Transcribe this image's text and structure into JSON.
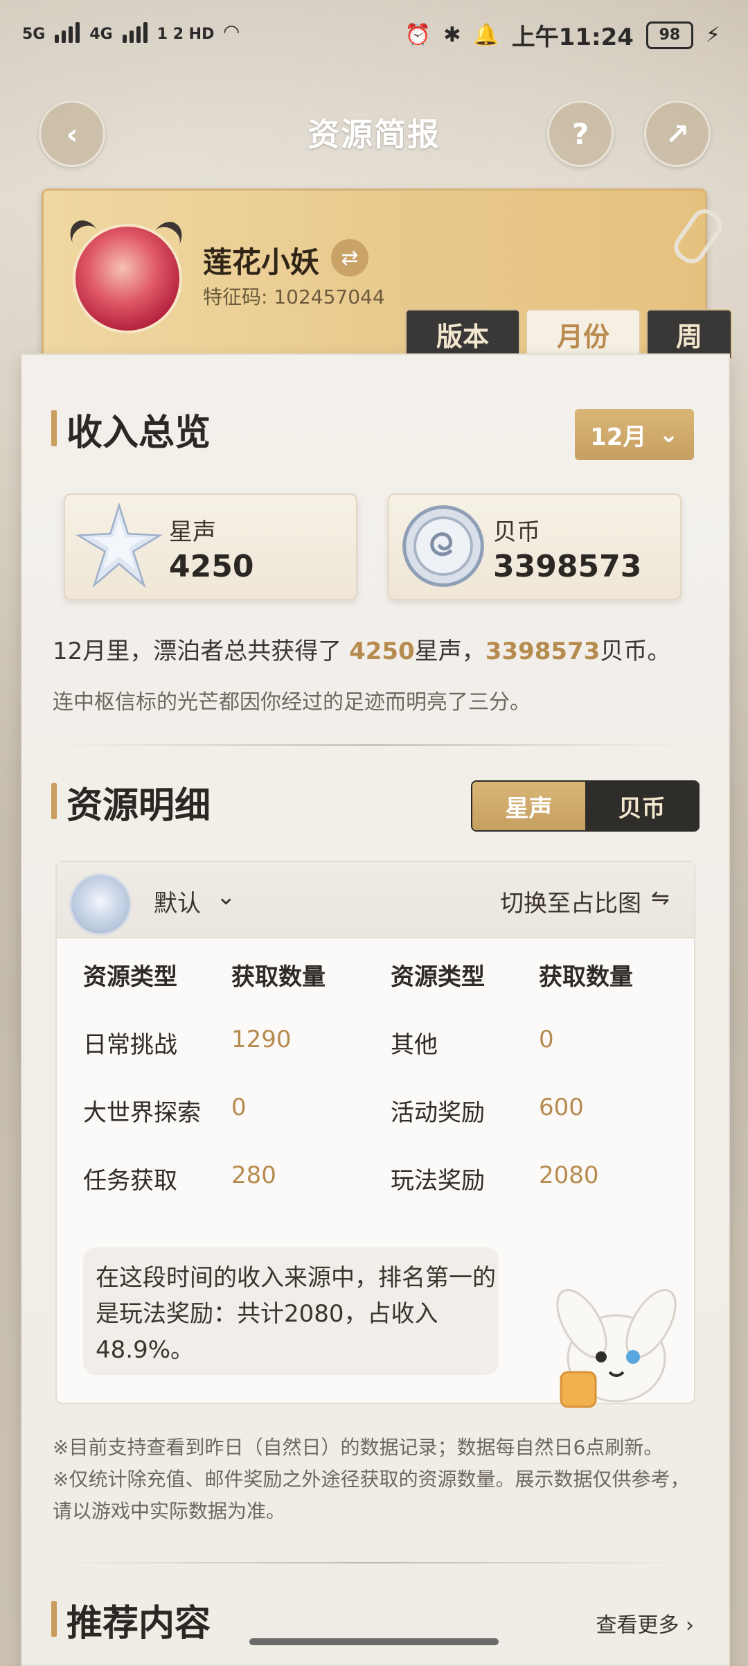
{
  "status_bar": {
    "network_1": "5G",
    "network_2": "4G",
    "extra": "1 2 HD",
    "time": "上午11:24",
    "battery": "98"
  },
  "header": {
    "title": "资源简报"
  },
  "profile": {
    "username": "莲花小妖",
    "uid_label": "特征码: 102457044"
  },
  "tabs": [
    {
      "label": "版本",
      "active": false
    },
    {
      "label": "月份",
      "active": true
    },
    {
      "label": "周",
      "active": false
    }
  ],
  "income_overview": {
    "title": "收入总览",
    "month_select": "12月",
    "cards": [
      {
        "label": "星声",
        "value": "4250",
        "icon": "star-crystal-icon"
      },
      {
        "label": "贝币",
        "value": "3398573",
        "icon": "shell-coin-icon"
      }
    ],
    "summary": {
      "prefix": "12月里，漂泊者总共获得了 ",
      "star_value": "4250",
      "star_unit": "星声，",
      "coin_value": "3398573",
      "coin_unit": "贝币。"
    },
    "flavor": "连中枢信标的光芒都因你经过的足迹而明亮了三分。"
  },
  "resource_detail": {
    "title": "资源明细",
    "segments": [
      "星声",
      "贝币"
    ],
    "active_segment": "星声",
    "filter": {
      "label": "默认",
      "icon": "star-crystal-icon"
    },
    "switch_label": "切换至占比图",
    "headers": [
      "资源类型",
      "获取数量",
      "资源类型",
      "获取数量"
    ],
    "rows": [
      {
        "left_name": "日常挑战",
        "left_value": "1290",
        "right_name": "其他",
        "right_value": "0"
      },
      {
        "left_name": "大世界探索",
        "left_value": "0",
        "right_name": "活动奖励",
        "right_value": "600"
      },
      {
        "left_name": "任务获取",
        "left_value": "280",
        "right_name": "玩法奖励",
        "right_value": "2080"
      }
    ],
    "insight": "在这段时间的收入来源中，排名第一的是玩法奖励：共计2080，占收入48.9%。"
  },
  "notes": [
    "※目前支持查看到昨日（自然日）的数据记录；数据每自然日6点刷新。",
    "※仅统计除充值、邮件奖励之外途径获取的资源数量。展示数据仅供参考，请以游戏中实际数据为准。"
  ],
  "recommend": {
    "title": "推荐内容",
    "more": "查看更多 ›"
  },
  "colors": {
    "accent_gold": "#c99d5d",
    "value_gold": "#b68b4f",
    "dark_tab": "#3a3836"
  }
}
